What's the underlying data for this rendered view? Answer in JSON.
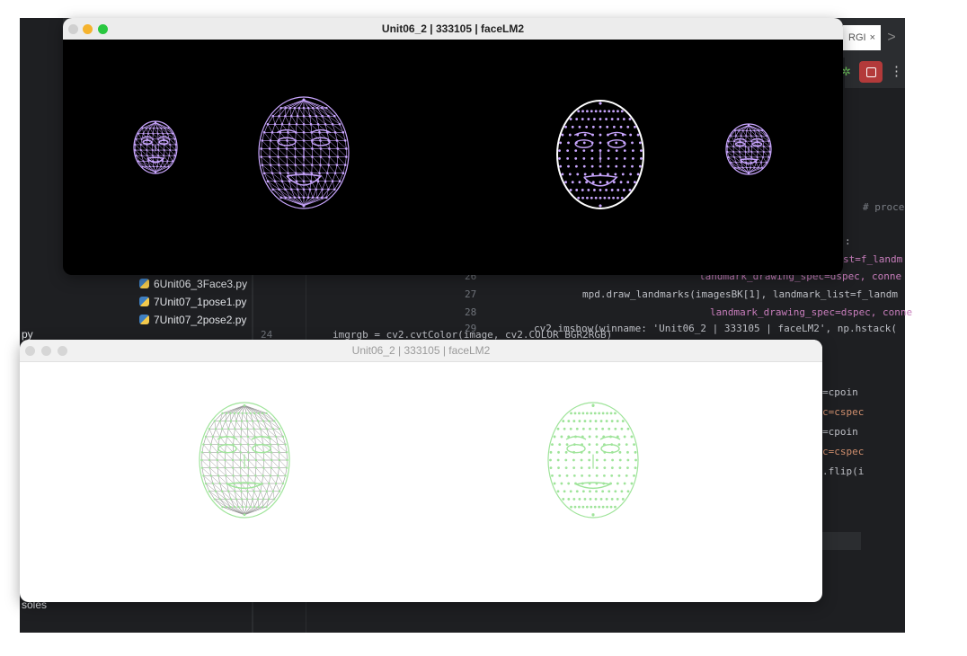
{
  "window_top": {
    "title": "Unit06_2 | 333105 | faceLM2",
    "traffic_colors": [
      "#d0d0d0",
      "#f5b32e",
      "#2ac840"
    ],
    "mesh_color": "#c9a6ff"
  },
  "window_bottom": {
    "title": "Unit06_2 | 333105 | faceLM2",
    "traffic_colors": [
      "#d6d6d6",
      "#d6d6d6",
      "#d6d6d6"
    ],
    "mesh_color": "#9fe49a"
  },
  "ide": {
    "tab_label": "RGI",
    "tab_close": "×",
    "nav_next": ">",
    "files": [
      "6Unit06_3Face3.py",
      "7Unit07_1pose1.py",
      "7Unit07_2pose2.py"
    ],
    "sidebar_top_label": "py",
    "sidebar_bottom_label": "soles",
    "code_comment": "# proce",
    "code_colon": ":",
    "code_right_1": "st=f_landm",
    "code_line_26": "landmark_drawing_spec=dspec, conne",
    "code_line_27": "mpd.draw_landmarks(imagesBK[1], landmark_list=f_landm",
    "code_line_28": "landmark_drawing_spec=dspec, conne",
    "code_line_29": "imgrgb = cv2.cvtColor(image, cv2.COLOR_BGR2RGB)",
    "code_line_29b": "cv2.imshow(winname: 'Unit06_2 | 333105 | faceLM2', np.hstack(",
    "line_numbers": [
      "26",
      "27",
      "28",
      "29",
      "24"
    ],
    "right_code": [
      "=cpoin",
      "c=cspec",
      "=cpoin",
      "c=cspec",
      ".flip(i"
    ]
  }
}
